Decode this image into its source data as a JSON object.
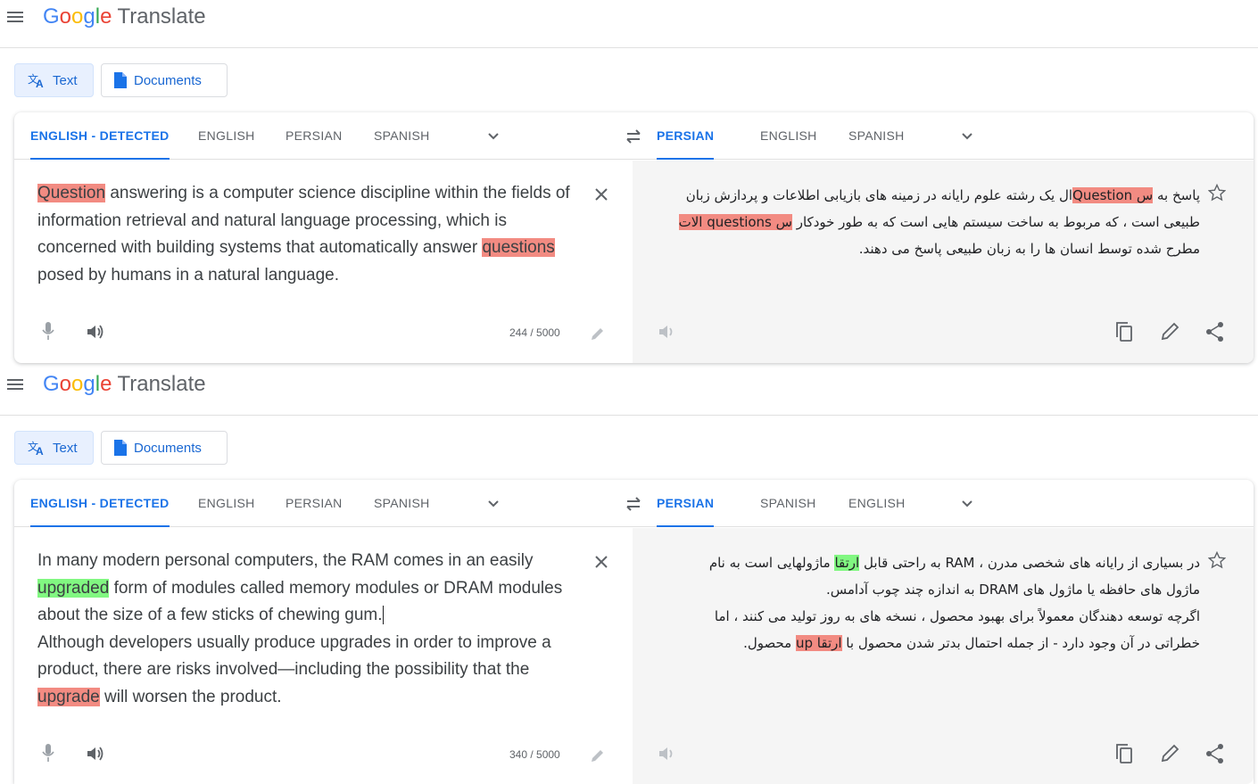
{
  "panels": [
    {
      "app": {
        "logo_letters": [
          "G",
          "o",
          "o",
          "g",
          "l",
          "e"
        ],
        "product": "Translate"
      },
      "modes": {
        "text": "Text",
        "documents": "Documents"
      },
      "source_tabs": [
        "ENGLISH - DETECTED",
        "ENGLISH",
        "PERSIAN",
        "SPANISH"
      ],
      "target_tabs": [
        "PERSIAN",
        "ENGLISH",
        "SPANISH"
      ],
      "source": {
        "segments": [
          {
            "text": "Question",
            "hl": "red"
          },
          {
            "text": " answering is a computer science discipline within the fields of information retrieval and natural language processing, which is concerned with building systems that automatically answer ",
            "hl": ""
          },
          {
            "text": "questions",
            "hl": "red"
          },
          {
            "text": " posed by humans in a natural language.",
            "hl": ""
          }
        ],
        "char_count": "244 / 5000"
      },
      "target": {
        "lines": [
          [
            {
              "text": "پاسخ به ",
              "hl": ""
            },
            {
              "text": "س Question",
              "hl": "red"
            },
            {
              "text": "ال یک رشته علوم رایانه در زمینه های بازیابی اطلاعات و پردازش زبان",
              "hl": ""
            }
          ],
          [
            {
              "text": "طبیعی است ، که مربوط به ساخت سیستم هایی است که به طور خودکار ",
              "hl": ""
            },
            {
              "text": "س questions الات",
              "hl": "red"
            }
          ],
          [
            {
              "text": "مطرح شده توسط انسان ها را به زبان طبیعی پاسخ می دهند.",
              "hl": ""
            }
          ]
        ]
      }
    },
    {
      "app": {
        "logo_letters": [
          "G",
          "o",
          "o",
          "g",
          "l",
          "e"
        ],
        "product": "Translate"
      },
      "modes": {
        "text": "Text",
        "documents": "Documents"
      },
      "source_tabs": [
        "ENGLISH - DETECTED",
        "ENGLISH",
        "PERSIAN",
        "SPANISH"
      ],
      "target_tabs": [
        "PERSIAN",
        "SPANISH",
        "ENGLISH"
      ],
      "source": {
        "segments": [
          {
            "text": "In many modern personal computers, the RAM comes in an easily ",
            "hl": ""
          },
          {
            "text": "upgraded",
            "hl": "green"
          },
          {
            "text": " form of modules called memory modules or DRAM modules about the size of a few sticks of chewing gum.",
            "hl": "",
            "caret": true
          },
          {
            "text": "\nAlthough developers usually produce upgrades in order to improve a product, there are risks involved—including the possibility that the ",
            "hl": ""
          },
          {
            "text": "upgrade",
            "hl": "red"
          },
          {
            "text": " will worsen the product.",
            "hl": ""
          }
        ],
        "char_count": "340 / 5000"
      },
      "target": {
        "lines": [
          [
            {
              "text": "در بسیاری از رایانه های شخصی مدرن ، RAM به راحتی قابل ",
              "hl": ""
            },
            {
              "text": "ارتقا",
              "hl": "green"
            },
            {
              "text": " ماژولهایی است به نام",
              "hl": ""
            }
          ],
          [
            {
              "text": "ماژول های حافظه یا ماژول های DRAM به اندازه چند چوب آدامس.",
              "hl": ""
            }
          ],
          [
            {
              "text": "اگرچه توسعه دهندگان معمولاً برای بهبود محصول ، نسخه های به روز تولید می کنند ، اما",
              "hl": ""
            }
          ],
          [
            {
              "text": "خطراتی در آن وجود دارد - از جمله احتمال بدتر شدن محصول با ",
              "hl": ""
            },
            {
              "text": "ارتقا up",
              "hl": "red"
            },
            {
              "text": " محصول.",
              "hl": ""
            }
          ]
        ]
      }
    }
  ]
}
